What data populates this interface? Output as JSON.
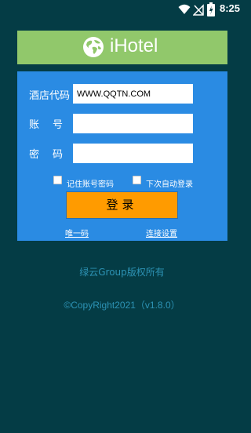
{
  "status_bar": {
    "time": "8:25",
    "icons": [
      "wifi-icon",
      "signal-icon",
      "battery-icon"
    ]
  },
  "header": {
    "app_name": "iHotel",
    "logo_icon": "globe-icon"
  },
  "form": {
    "hotel_code_label": "酒店代码",
    "hotel_code_value": "WWW.QQTN.COM",
    "account_label": "账号",
    "account_value": "",
    "password_label": "密码",
    "password_value": "",
    "remember_label": "记住账号密码",
    "auto_login_label": "下次自动登录",
    "login_button": "登录",
    "unique_code_link": "唯一码",
    "connection_settings_link": "连接设置"
  },
  "footer": {
    "owner": "绿云Group版权所有",
    "copyright": "©CopyRight2021（v1.8.0）"
  },
  "colors": {
    "background": "#043c45",
    "banner": "#91c86b",
    "card": "#2a8be3",
    "button": "#ff9b00",
    "footer_text": "#2d93b5"
  }
}
